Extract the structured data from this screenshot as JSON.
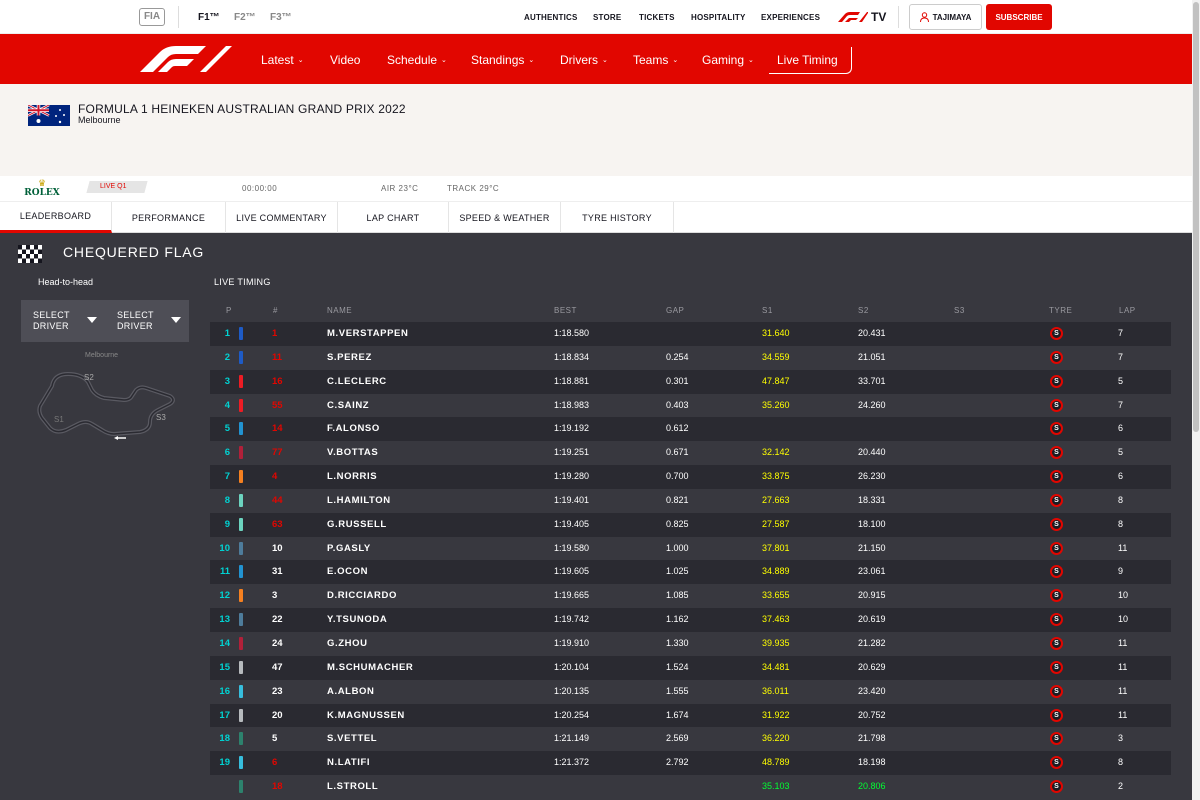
{
  "topbar": {
    "fia": "FIA",
    "series": [
      "F1™",
      "F2™",
      "F3™"
    ],
    "links": [
      "AUTHENTICS",
      "STORE",
      "TICKETS",
      "HOSPITALITY",
      "EXPERIENCES"
    ],
    "f1tv": "TV",
    "user": "TAJIMAYA",
    "subscribe": "SUBSCRIBE"
  },
  "nav": {
    "items": [
      "Latest",
      "Video",
      "Schedule",
      "Standings",
      "Drivers",
      "Teams",
      "Gaming"
    ],
    "chevron_items": [
      true,
      false,
      true,
      true,
      true,
      true,
      true
    ],
    "live_timing": "Live Timing"
  },
  "event": {
    "title": "FORMULA 1 HEINEKEN AUSTRALIAN GRAND PRIX 2022",
    "location": "Melbourne",
    "sponsor": "ROLEX",
    "session": "LIVE Q1",
    "clock": "00:00:00",
    "air": "AIR 23°C",
    "track": "TRACK 29°C"
  },
  "tabs": [
    "LEADERBOARD",
    "PERFORMANCE",
    "LIVE COMMENTARY",
    "LAP CHART",
    "SPEED & WEATHER",
    "TYRE HISTORY"
  ],
  "panel": {
    "flag_status": "CHEQUERED FLAG",
    "head_to_head": "Head-to-head",
    "select_driver": [
      "SELECT",
      "DRIVER"
    ],
    "track_name": "Melbourne",
    "sectors": [
      "S2",
      "S3",
      "S1"
    ],
    "live_timing_label": "LIVE TIMING"
  },
  "columns": [
    "P",
    "#",
    "NAME",
    "BEST",
    "GAP",
    "S1",
    "S2",
    "S3",
    "TYRE",
    "LAP"
  ],
  "colors": {
    "f1_red": "#e10600",
    "position_cyan": "#00d2d2",
    "sector_yellow": "#ffff00",
    "sector_green": "#00ff32",
    "row_dark": "#2a2a31",
    "row_light": "#38383f"
  },
  "rows": [
    {
      "pos": "1",
      "team_color": "#1e5bc6",
      "num": "1",
      "num_red": true,
      "name": "M.VERSTAPPEN",
      "best": "1:18.580",
      "gap": "",
      "s1": "31.640",
      "s2": "20.431",
      "s3": "",
      "tyre": "S",
      "lap": "7"
    },
    {
      "pos": "2",
      "team_color": "#1e5bc6",
      "num": "11",
      "num_red": true,
      "name": "S.PEREZ",
      "best": "1:18.834",
      "gap": "0.254",
      "s1": "34.559",
      "s2": "21.051",
      "s3": "",
      "tyre": "S",
      "lap": "7"
    },
    {
      "pos": "3",
      "team_color": "#ed1c24",
      "num": "16",
      "num_red": true,
      "name": "C.LECLERC",
      "best": "1:18.881",
      "gap": "0.301",
      "s1": "47.847",
      "s2": "33.701",
      "s3": "",
      "tyre": "S",
      "lap": "5"
    },
    {
      "pos": "4",
      "team_color": "#ed1c24",
      "num": "55",
      "num_red": true,
      "name": "C.SAINZ",
      "best": "1:18.983",
      "gap": "0.403",
      "s1": "35.260",
      "s2": "24.260",
      "s3": "",
      "tyre": "S",
      "lap": "7"
    },
    {
      "pos": "5",
      "team_color": "#2293d1",
      "num": "14",
      "num_red": true,
      "name": "F.ALONSO",
      "best": "1:19.192",
      "gap": "0.612",
      "s1": "",
      "s2": "",
      "s3": "",
      "tyre": "S",
      "lap": "6"
    },
    {
      "pos": "6",
      "team_color": "#b12039",
      "num": "77",
      "num_red": true,
      "name": "V.BOTTAS",
      "best": "1:19.251",
      "gap": "0.671",
      "s1": "32.142",
      "s2": "20.440",
      "s3": "",
      "tyre": "S",
      "lap": "5"
    },
    {
      "pos": "7",
      "team_color": "#f58020",
      "num": "4",
      "num_red": true,
      "name": "L.NORRIS",
      "best": "1:19.280",
      "gap": "0.700",
      "s1": "33.875",
      "s2": "26.230",
      "s3": "",
      "tyre": "S",
      "lap": "6"
    },
    {
      "pos": "8",
      "team_color": "#6cd3bf",
      "num": "44",
      "num_red": true,
      "name": "L.HAMILTON",
      "best": "1:19.401",
      "gap": "0.821",
      "s1": "27.663",
      "s2": "18.331",
      "s3": "",
      "tyre": "S",
      "lap": "8"
    },
    {
      "pos": "9",
      "team_color": "#6cd3bf",
      "num": "63",
      "num_red": true,
      "name": "G.RUSSELL",
      "best": "1:19.405",
      "gap": "0.825",
      "s1": "27.587",
      "s2": "18.100",
      "s3": "",
      "tyre": "S",
      "lap": "8"
    },
    {
      "pos": "10",
      "team_color": "#4e7c9b",
      "num": "10",
      "num_red": false,
      "name": "P.GASLY",
      "best": "1:19.580",
      "gap": "1.000",
      "s1": "37.801",
      "s2": "21.150",
      "s3": "",
      "tyre": "S",
      "lap": "11"
    },
    {
      "pos": "11",
      "team_color": "#2293d1",
      "num": "31",
      "num_red": false,
      "name": "E.OCON",
      "best": "1:19.605",
      "gap": "1.025",
      "s1": "34.889",
      "s2": "23.061",
      "s3": "",
      "tyre": "S",
      "lap": "9"
    },
    {
      "pos": "12",
      "team_color": "#f58020",
      "num": "3",
      "num_red": false,
      "name": "D.RICCIARDO",
      "best": "1:19.665",
      "gap": "1.085",
      "s1": "33.655",
      "s2": "20.915",
      "s3": "",
      "tyre": "S",
      "lap": "10"
    },
    {
      "pos": "13",
      "team_color": "#4e7c9b",
      "num": "22",
      "num_red": false,
      "name": "Y.TSUNODA",
      "best": "1:19.742",
      "gap": "1.162",
      "s1": "37.463",
      "s2": "20.619",
      "s3": "",
      "tyre": "S",
      "lap": "10"
    },
    {
      "pos": "14",
      "team_color": "#b12039",
      "num": "24",
      "num_red": false,
      "name": "G.ZHOU",
      "best": "1:19.910",
      "gap": "1.330",
      "s1": "39.935",
      "s2": "21.282",
      "s3": "",
      "tyre": "S",
      "lap": "11"
    },
    {
      "pos": "15",
      "team_color": "#b6babd",
      "num": "47",
      "num_red": false,
      "name": "M.SCHUMACHER",
      "best": "1:20.104",
      "gap": "1.524",
      "s1": "34.481",
      "s2": "20.629",
      "s3": "",
      "tyre": "S",
      "lap": "11"
    },
    {
      "pos": "16",
      "team_color": "#37bedd",
      "num": "23",
      "num_red": false,
      "name": "A.ALBON",
      "best": "1:20.135",
      "gap": "1.555",
      "s1": "36.011",
      "s2": "23.420",
      "s3": "",
      "tyre": "S",
      "lap": "11"
    },
    {
      "pos": "17",
      "team_color": "#b6babd",
      "num": "20",
      "num_red": false,
      "name": "K.MAGNUSSEN",
      "best": "1:20.254",
      "gap": "1.674",
      "s1": "31.922",
      "s2": "20.752",
      "s3": "",
      "tyre": "S",
      "lap": "11"
    },
    {
      "pos": "18",
      "team_color": "#2d826d",
      "num": "5",
      "num_red": false,
      "name": "S.VETTEL",
      "best": "1:21.149",
      "gap": "2.569",
      "s1": "36.220",
      "s2": "21.798",
      "s3": "",
      "tyre": "S",
      "lap": "3"
    },
    {
      "pos": "19",
      "team_color": "#37bedd",
      "num": "6",
      "num_red": true,
      "name": "N.LATIFI",
      "best": "1:21.372",
      "gap": "2.792",
      "s1": "48.789",
      "s2": "18.198",
      "s3": "",
      "tyre": "S",
      "lap": "8"
    },
    {
      "pos": "",
      "team_color": "#2d826d",
      "num": "18",
      "num_red": true,
      "name": "L.STROLL",
      "best": "",
      "gap": "",
      "s1": "35.103",
      "s2": "20.806",
      "s3": "",
      "tyre": "S",
      "lap": "2",
      "s1_green": true,
      "s2_green": true
    }
  ]
}
